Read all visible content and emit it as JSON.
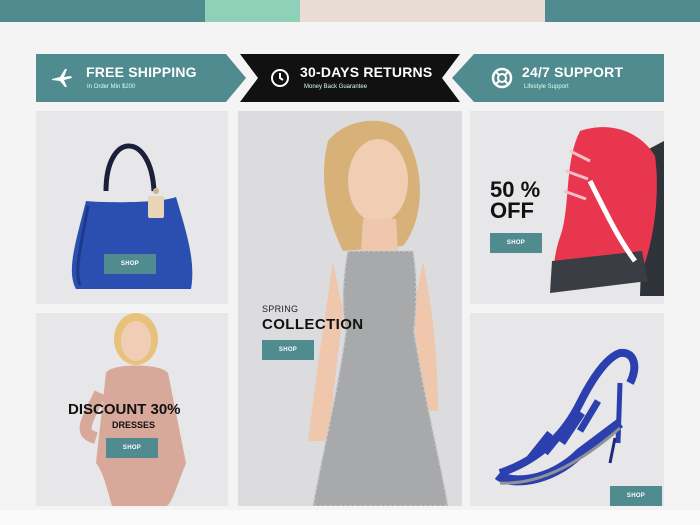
{
  "features": [
    {
      "title": "FREE SHIPPING",
      "subtitle": "In Order Min $200",
      "icon": "airplane-icon"
    },
    {
      "title": "30-DAYS RETURNS",
      "subtitle": "Money Back Guarantee",
      "icon": "clock-icon"
    },
    {
      "title": "24/7 SUPPORT",
      "subtitle": "Lifestyle Support",
      "icon": "lifebuoy-icon"
    }
  ],
  "tiles": {
    "bag": {
      "shop_label": "SHOP",
      "image": "blue-handbag"
    },
    "dress": {
      "title": "DISCOUNT 30%",
      "subtitle": "DRESSES",
      "shop_label": "SHOP",
      "image": "woman-pink-dress"
    },
    "center": {
      "kicker": "SPRING",
      "title": "COLLECTION",
      "shop_label": "SHOP",
      "image": "woman-sequin-gown"
    },
    "sneaker": {
      "offer_line1": "50 %",
      "offer_line2": "OFF",
      "shop_label": "SHOP",
      "image": "red-sneaker"
    },
    "sandal": {
      "shop_label": "SHOP",
      "image": "blue-strappy-sandal"
    }
  },
  "colors": {
    "accent": "#4f8b8f",
    "dark": "#111111",
    "tile_bg": "#e7e6e8"
  }
}
